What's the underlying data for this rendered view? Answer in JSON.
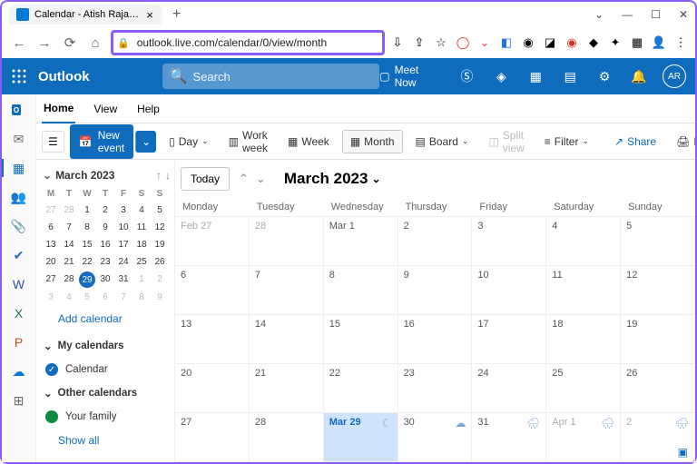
{
  "browser": {
    "tab_title": "Calendar - Atish Rajasekharan - ",
    "url": "outlook.live.com/calendar/0/view/month"
  },
  "header": {
    "brand": "Outlook",
    "search_placeholder": "Search",
    "meet_now": "Meet Now",
    "avatar_initials": "AR"
  },
  "tabs": {
    "home": "Home",
    "view": "View",
    "help": "Help"
  },
  "toolbar": {
    "new_event": "New event",
    "day": "Day",
    "workweek": "Work week",
    "week": "Week",
    "month": "Month",
    "board": "Board",
    "splitview": "Split view",
    "filter": "Filter",
    "share": "Share",
    "print": "Print"
  },
  "sidebar": {
    "month_label": "March 2023",
    "add_calendar": "Add calendar",
    "my_calendars": "My calendars",
    "calendar": "Calendar",
    "other_calendars": "Other calendars",
    "your_family": "Your family",
    "show_all": "Show all",
    "day_headers": [
      "M",
      "T",
      "W",
      "T",
      "F",
      "S",
      "S"
    ],
    "mini_grid": [
      [
        {
          "d": "27",
          "o": true
        },
        {
          "d": "28",
          "o": true
        },
        {
          "d": "1"
        },
        {
          "d": "2"
        },
        {
          "d": "3"
        },
        {
          "d": "4"
        },
        {
          "d": "5"
        }
      ],
      [
        {
          "d": "6"
        },
        {
          "d": "7"
        },
        {
          "d": "8"
        },
        {
          "d": "9"
        },
        {
          "d": "10"
        },
        {
          "d": "11"
        },
        {
          "d": "12"
        }
      ],
      [
        {
          "d": "13"
        },
        {
          "d": "14"
        },
        {
          "d": "15"
        },
        {
          "d": "16"
        },
        {
          "d": "17"
        },
        {
          "d": "18"
        },
        {
          "d": "19"
        }
      ],
      [
        {
          "d": "20"
        },
        {
          "d": "21"
        },
        {
          "d": "22"
        },
        {
          "d": "23"
        },
        {
          "d": "24"
        },
        {
          "d": "25"
        },
        {
          "d": "26"
        }
      ],
      [
        {
          "d": "27"
        },
        {
          "d": "28"
        },
        {
          "d": "29",
          "today": true
        },
        {
          "d": "30"
        },
        {
          "d": "31"
        },
        {
          "d": "1",
          "o": true
        },
        {
          "d": "2",
          "o": true
        }
      ],
      [
        {
          "d": "3",
          "o": true
        },
        {
          "d": "4",
          "o": true
        },
        {
          "d": "5",
          "o": true
        },
        {
          "d": "6",
          "o": true
        },
        {
          "d": "7",
          "o": true
        },
        {
          "d": "8",
          "o": true
        },
        {
          "d": "9",
          "o": true
        }
      ]
    ]
  },
  "month_view": {
    "today": "Today",
    "title": "March 2023",
    "day_headers": [
      "Monday",
      "Tuesday",
      "Wednesday",
      "Thursday",
      "Friday",
      "Saturday",
      "Sunday"
    ],
    "weeks": [
      [
        {
          "label": "Feb 27",
          "o": true
        },
        {
          "label": "28",
          "o": true
        },
        {
          "label": "Mar 1"
        },
        {
          "label": "2"
        },
        {
          "label": "3"
        },
        {
          "label": "4"
        },
        {
          "label": "5"
        }
      ],
      [
        {
          "label": "6"
        },
        {
          "label": "7"
        },
        {
          "label": "8"
        },
        {
          "label": "9"
        },
        {
          "label": "10"
        },
        {
          "label": "11"
        },
        {
          "label": "12"
        }
      ],
      [
        {
          "label": "13"
        },
        {
          "label": "14"
        },
        {
          "label": "15"
        },
        {
          "label": "16"
        },
        {
          "label": "17"
        },
        {
          "label": "18"
        },
        {
          "label": "19"
        }
      ],
      [
        {
          "label": "20"
        },
        {
          "label": "21"
        },
        {
          "label": "22"
        },
        {
          "label": "23"
        },
        {
          "label": "24"
        },
        {
          "label": "25"
        },
        {
          "label": "26"
        }
      ],
      [
        {
          "label": "27"
        },
        {
          "label": "28"
        },
        {
          "label": "Mar 29",
          "today": true,
          "weather": "moon"
        },
        {
          "label": "30",
          "weather": "cloud"
        },
        {
          "label": "31",
          "weather": "rain"
        },
        {
          "label": "Apr 1",
          "o": true,
          "weather": "rain"
        },
        {
          "label": "2",
          "o": true,
          "weather": "rain"
        }
      ]
    ]
  }
}
